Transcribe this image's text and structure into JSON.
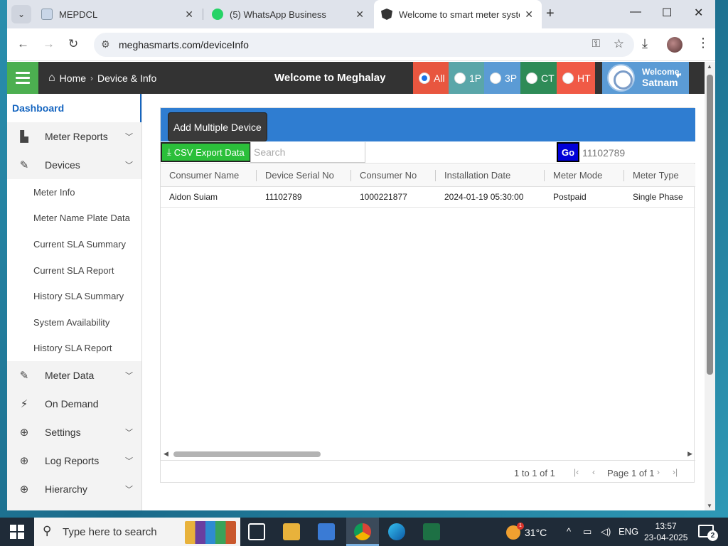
{
  "browser": {
    "tabs": [
      {
        "label": "MEPDCL",
        "active": false
      },
      {
        "label": "(5) WhatsApp Business",
        "active": false
      },
      {
        "label": "Welcome to smart meter systen",
        "active": true
      }
    ],
    "url": "meghasmarts.com/deviceInfo"
  },
  "header": {
    "breadcrumb_home": "Home",
    "breadcrumb_current": "Device & Info",
    "welcome": "Welcome to Meghalay",
    "filters": [
      {
        "label": "All",
        "color": "#e8563f",
        "selected": true
      },
      {
        "label": "1P",
        "color": "#5aa6a9",
        "selected": false
      },
      {
        "label": "3P",
        "color": "#5b9bd5",
        "selected": false
      },
      {
        "label": "CT",
        "color": "#2e8b57",
        "selected": false
      },
      {
        "label": "HT",
        "color": "#f05a46",
        "selected": false
      }
    ],
    "user_greeting": "Welcome,",
    "user_name": "Satnam"
  },
  "sidebar": {
    "dashboard": "Dashboard",
    "items": [
      {
        "label": "Meter Reports",
        "icon": "file-icon"
      },
      {
        "label": "Devices",
        "icon": "edit-icon"
      }
    ],
    "device_subitems": [
      "Meter Info",
      "Meter Name Plate Data",
      "Current SLA Summary",
      "Current SLA Report",
      "History SLA Summary",
      "System Availability",
      "History SLA Report"
    ],
    "bottom_items": [
      {
        "label": "Meter Data",
        "icon": "edit-icon"
      },
      {
        "label": "On Demand",
        "icon": "plug-icon"
      },
      {
        "label": "Settings",
        "icon": "download-circle-icon"
      },
      {
        "label": "Log Reports",
        "icon": "download-circle-icon"
      },
      {
        "label": "Hierarchy",
        "icon": "download-circle-icon"
      }
    ]
  },
  "main": {
    "add_multiple_label": "Add Multiple Device",
    "csv_export_label": "CSV Export Data",
    "search_placeholder": "Search",
    "go_label": "Go",
    "serial_value": "11102789",
    "columns": [
      "Consumer Name",
      "Device Serial No",
      "Consumer No",
      "Installation Date",
      "Meter Mode",
      "Meter Type"
    ],
    "rows": [
      [
        "Aidon Suiam",
        "11102789",
        "1000221877",
        "2024-01-19 05:30:00",
        "Postpaid",
        "Single Phase"
      ]
    ],
    "pager_summary": "1 to 1 of 1",
    "pager_page": "Page 1 of 1"
  },
  "taskbar": {
    "search_placeholder": "Type here to search",
    "temperature": "31°C",
    "weather_badge": "1",
    "language": "ENG",
    "time": "13:57",
    "date": "23-04-2025",
    "notifications": "2"
  }
}
